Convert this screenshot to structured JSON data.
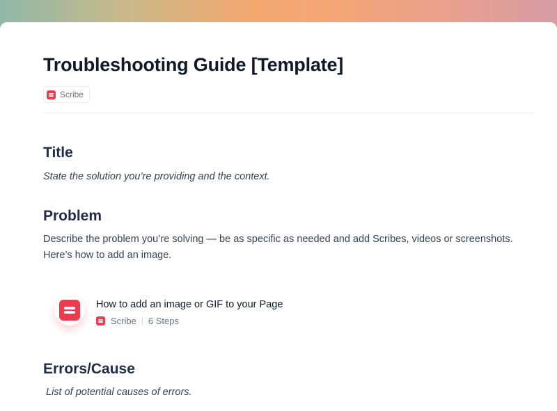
{
  "document": {
    "title": "Troubleshooting Guide [Template]",
    "author": "Scribe"
  },
  "sections": {
    "title": {
      "heading": "Title",
      "text": "State the solution you’re providing and the context."
    },
    "problem": {
      "heading": "Problem",
      "text": "Describe the problem you’re solving — be as specific as needed and add Scribes, videos or screenshots. Here’s how to add an image."
    },
    "errors": {
      "heading": "Errors/Cause",
      "text": "List of potential causes of errors."
    }
  },
  "embed": {
    "title": "How to add an image or GIF to your Page",
    "author": "Scribe",
    "steps": "6 Steps"
  },
  "colors": {
    "brand": "#f0384f",
    "heading": "#1f2a44",
    "text": "#374151"
  },
  "icons": {
    "author_logo": "scribe-logo-icon",
    "embed_logo": "scribe-logo-icon"
  }
}
